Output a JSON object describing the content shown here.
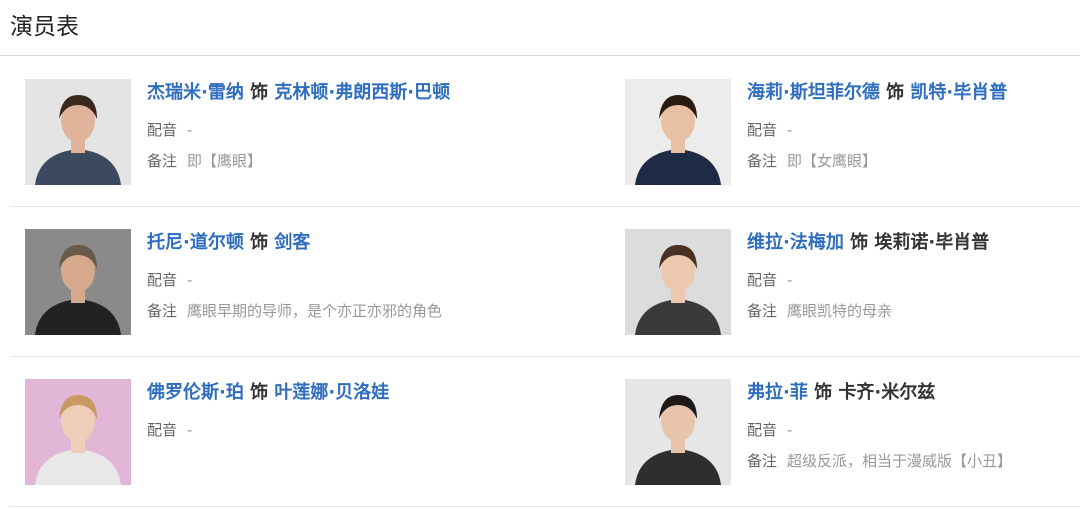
{
  "header": {
    "title": "演员表"
  },
  "cast": [
    {
      "actor": "杰瑞米·雷纳",
      "as": "饰",
      "role": "克林顿·弗朗西斯·巴顿",
      "role_link": true,
      "dub_label": "配音",
      "dub_value": "-",
      "note_label": "备注",
      "note_value": "即【鹰眼】",
      "photo": {
        "bg": "#e4e4e4",
        "skin": "#e0b49a",
        "hair": "#3a2a1e",
        "cloth": "#3b4a5e"
      }
    },
    {
      "actor": "海莉·斯坦菲尔德",
      "as": "饰",
      "role": "凯特·毕肖普",
      "role_link": true,
      "dub_label": "配音",
      "dub_value": "-",
      "note_label": "备注",
      "note_value": "即【女鹰眼】",
      "photo": {
        "bg": "#ececec",
        "skin": "#e8c0a4",
        "hair": "#2a1a12",
        "cloth": "#1f2a44"
      }
    },
    {
      "actor": "托尼·道尔顿",
      "as": "饰",
      "role": "剑客",
      "role_link": true,
      "dub_label": "配音",
      "dub_value": "-",
      "note_label": "备注",
      "note_value": "鹰眼早期的导师，是个亦正亦邪的角色",
      "photo": {
        "bg": "#8a8a8a",
        "skin": "#d6a88c",
        "hair": "#6a5a4a",
        "cloth": "#222222"
      }
    },
    {
      "actor": "维拉·法梅加",
      "as": "饰",
      "role": "埃莉诺·毕肖普",
      "role_link": false,
      "dub_label": "配音",
      "dub_value": "-",
      "note_label": "备注",
      "note_value": "鹰眼凯特的母亲",
      "photo": {
        "bg": "#dcdcdc",
        "skin": "#ecc8b0",
        "hair": "#4a3022",
        "cloth": "#3a3a3a"
      }
    },
    {
      "actor": "佛罗伦斯·珀",
      "as": "饰",
      "role": "叶莲娜·贝洛娃",
      "role_link": true,
      "dub_label": "配音",
      "dub_value": "-",
      "note_label": "",
      "note_value": "",
      "photo": {
        "bg": "#e2b6d6",
        "skin": "#f0cdb8",
        "hair": "#c79a62",
        "cloth": "#e8e8e8"
      }
    },
    {
      "actor": "弗拉·菲",
      "as": "饰",
      "role": "卡齐·米尔兹",
      "role_link": false,
      "dub_label": "配音",
      "dub_value": "-",
      "note_label": "备注",
      "note_value": "超级反派，相当于漫威版【小丑】",
      "photo": {
        "bg": "#e6e6e6",
        "skin": "#e9c4ac",
        "hair": "#1e1a18",
        "cloth": "#2e2e2e"
      }
    }
  ]
}
